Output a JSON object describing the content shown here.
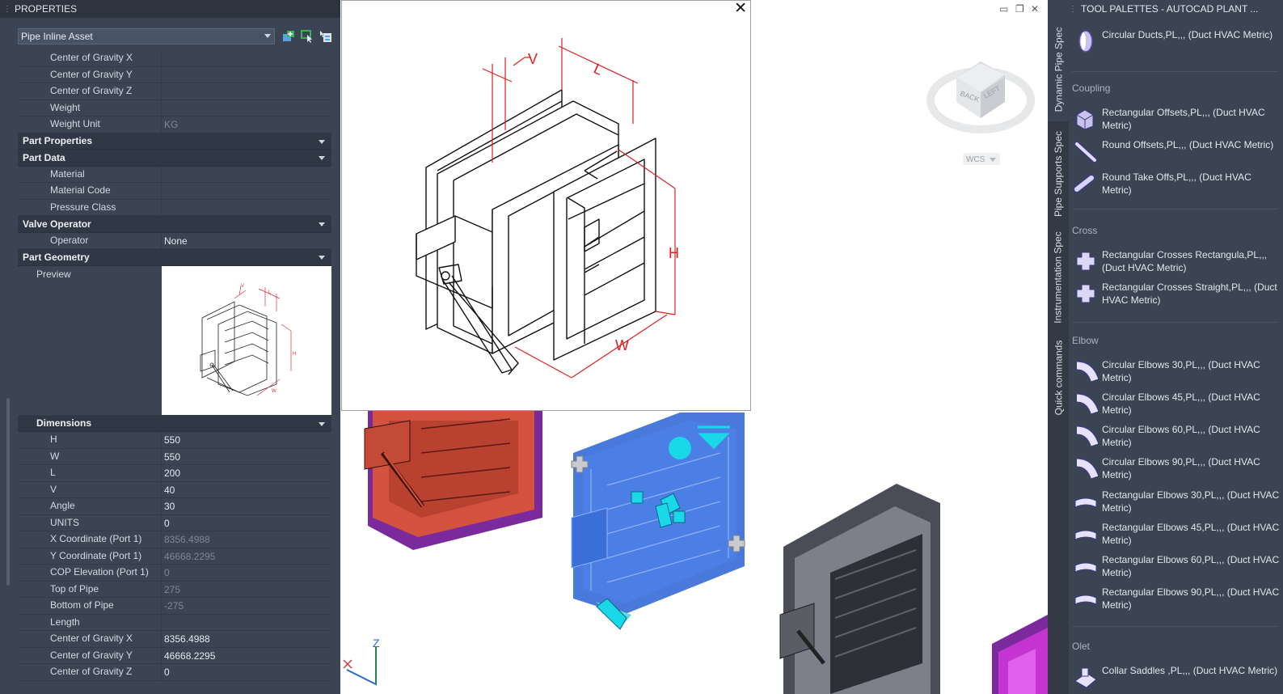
{
  "properties": {
    "title": "PROPERTIES",
    "selector": "Pipe Inline Asset",
    "rows_top": [
      {
        "k": "Center of Gravity X",
        "v": ""
      },
      {
        "k": "Center of Gravity Y",
        "v": ""
      },
      {
        "k": "Center of Gravity Z",
        "v": ""
      },
      {
        "k": "Weight",
        "v": ""
      },
      {
        "k": "Weight Unit",
        "v": "KG"
      }
    ],
    "cat_part_properties": "Part Properties",
    "cat_part_data": "Part Data",
    "rows_part_data": [
      {
        "k": "Material",
        "v": ""
      },
      {
        "k": "Material Code",
        "v": ""
      },
      {
        "k": "Pressure Class",
        "v": ""
      }
    ],
    "cat_valve_operator": "Valve Operator",
    "row_operator": {
      "k": "Operator",
      "v": "None"
    },
    "cat_part_geometry": "Part Geometry",
    "preview_label": "Preview",
    "cat_dimensions": "Dimensions",
    "dimensions": [
      {
        "k": "H",
        "v": "550"
      },
      {
        "k": "W",
        "v": "550"
      },
      {
        "k": "L",
        "v": "200"
      },
      {
        "k": "V",
        "v": "40"
      },
      {
        "k": "Angle",
        "v": "30"
      },
      {
        "k": "UNITS",
        "v": "0"
      }
    ],
    "rows_bottom": [
      {
        "k": "X Coordinate (Port 1)",
        "v": "8356.4988"
      },
      {
        "k": "Y Coordinate (Port 1)",
        "v": "46668.2295"
      },
      {
        "k": "COP Elevation (Port 1)",
        "v": "0"
      },
      {
        "k": "Top of Pipe",
        "v": "275"
      },
      {
        "k": "Bottom of Pipe",
        "v": "-275"
      },
      {
        "k": "Length",
        "v": ""
      },
      {
        "k": "Center of Gravity X",
        "v": "8356.4988"
      },
      {
        "k": "Center of Gravity Y",
        "v": "46668.2295"
      },
      {
        "k": "Center of Gravity Z",
        "v": "0"
      }
    ]
  },
  "viewport": {
    "popup_labels": {
      "v": "V",
      "l": "L",
      "h": "H",
      "w": "W"
    },
    "viewcube": {
      "back": "BACK",
      "left": "LEFT",
      "wcs": "WCS"
    },
    "axis_z": "Z",
    "colors": {
      "selected_blue": "#3a6fd8",
      "damper_red": "#d4533e",
      "damper_purple": "#7a2a9c",
      "damper_gray": "#4a4d55",
      "damper_magenta": "#c334d0"
    }
  },
  "palettes": {
    "title": "TOOL PALETTES - AUTOCAD PLANT ...",
    "tabs": [
      "Dynamic Pipe Spec",
      "Pipe Supports Spec",
      "Instrumentation Spec",
      "Quick commands"
    ],
    "items_top": [
      {
        "label": "Circular Ducts,PL,,, (Duct HVAC Metric)",
        "icon": "circular-duct-icon"
      }
    ],
    "sections": [
      {
        "name": "Coupling",
        "items": [
          {
            "label": "Rectangular Offsets,PL,,, (Duct HVAC Metric)",
            "icon": "rect-offset-icon"
          },
          {
            "label": "Round Offsets,PL,,, (Duct HVAC Metric)",
            "icon": "round-offset-icon"
          },
          {
            "label": "Round Take Offs,PL,,, (Duct HVAC Metric)",
            "icon": "round-takeoff-icon"
          }
        ]
      },
      {
        "name": "Cross",
        "items": [
          {
            "label": "Rectangular Crosses Rectangula,PL,,, (Duct HVAC Metric)",
            "icon": "rect-cross-icon"
          },
          {
            "label": "Rectangular Crosses Straight,PL,,, (Duct HVAC Metric)",
            "icon": "rect-cross-icon"
          }
        ]
      },
      {
        "name": "Elbow",
        "items": [
          {
            "label": "Circular Elbows 30,PL,,, (Duct HVAC Metric)",
            "icon": "circular-elbow-icon"
          },
          {
            "label": "Circular Elbows 45,PL,,, (Duct HVAC Metric)",
            "icon": "circular-elbow-icon"
          },
          {
            "label": "Circular Elbows 60,PL,,, (Duct HVAC Metric)",
            "icon": "circular-elbow-icon"
          },
          {
            "label": "Circular Elbows 90,PL,,, (Duct HVAC Metric)",
            "icon": "circular-elbow-icon"
          },
          {
            "label": "Rectangular Elbows 30,PL,,, (Duct HVAC Metric)",
            "icon": "rect-elbow-icon"
          },
          {
            "label": "Rectangular Elbows 45,PL,,, (Duct HVAC Metric)",
            "icon": "rect-elbow-icon"
          },
          {
            "label": "Rectangular Elbows 60,PL,,, (Duct HVAC Metric)",
            "icon": "rect-elbow-icon"
          },
          {
            "label": "Rectangular Elbows 90,PL,,, (Duct HVAC Metric)",
            "icon": "rect-elbow-icon"
          }
        ]
      },
      {
        "name": "Olet",
        "items": [
          {
            "label": "Collar Saddles ,PL,,, (Duct HVAC Metric)",
            "icon": "collar-saddle-icon"
          }
        ]
      }
    ]
  }
}
